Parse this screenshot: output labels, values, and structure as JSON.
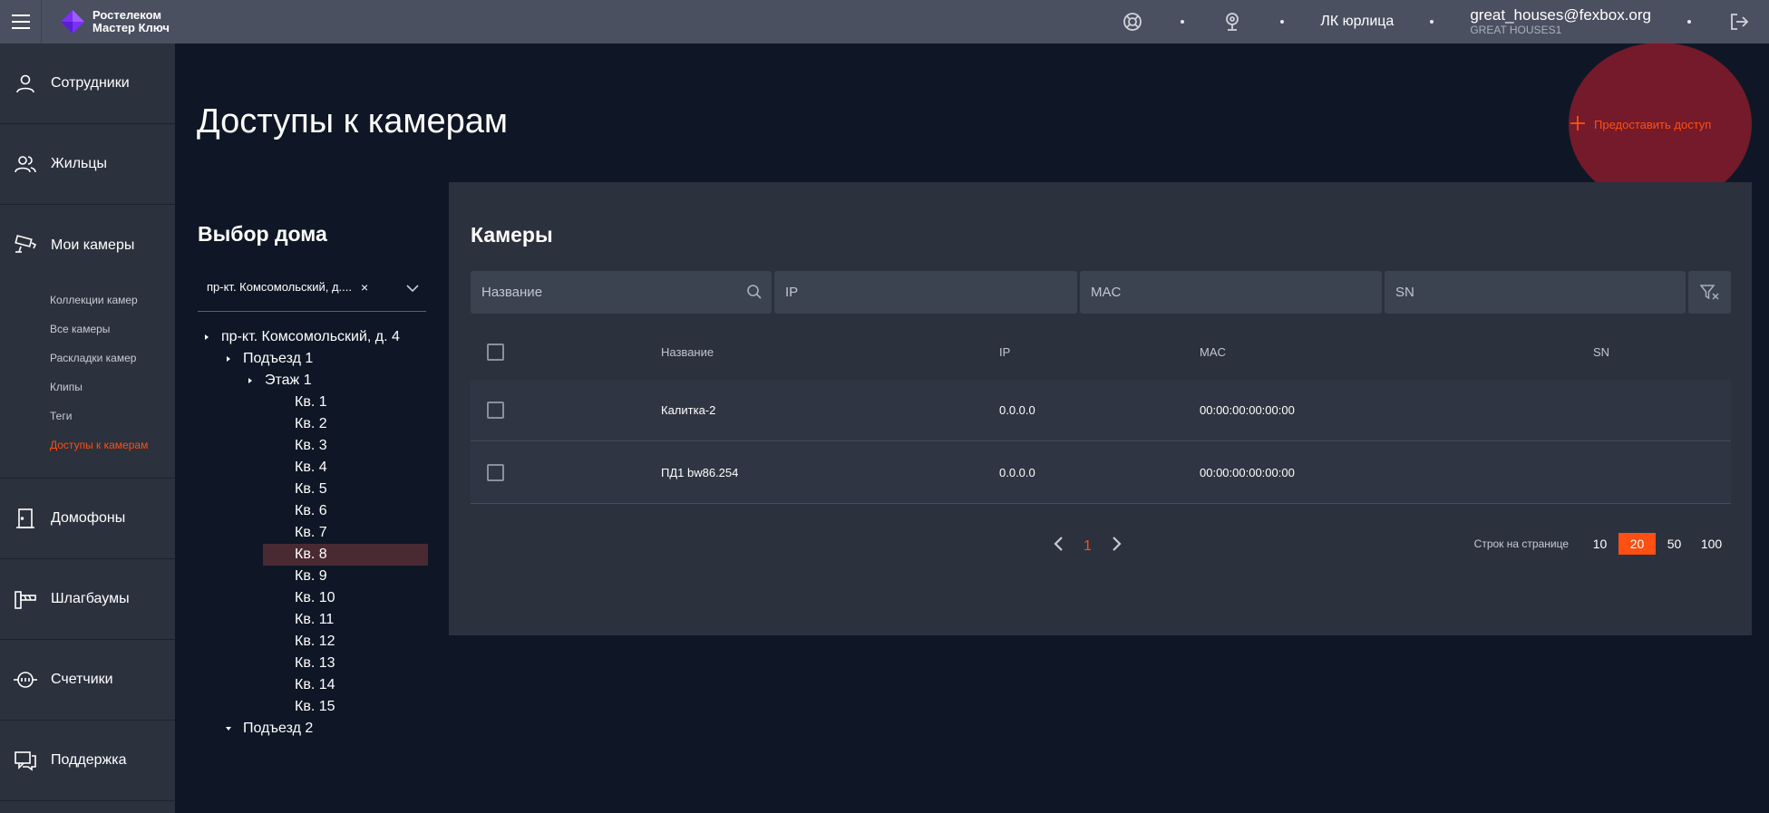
{
  "topbar": {
    "logo_line1": "Ростелеком",
    "logo_line2": "Мастер Ключ",
    "lk_label": "ЛК юрлица",
    "user_email": "great_houses@fexbox.org",
    "user_org": "GREAT HOUSES1"
  },
  "sidebar": {
    "employees": "Сотрудники",
    "residents": "Жильцы",
    "my_cameras": "Мои камеры",
    "sub": {
      "collections": "Коллекции камер",
      "all": "Все камеры",
      "layouts": "Раскладки камер",
      "clips": "Клипы",
      "tags": "Теги",
      "access": "Доступы к камерам"
    },
    "intercoms": "Домофоны",
    "barriers": "Шлагбаумы",
    "meters": "Счетчики",
    "support": "Поддержка"
  },
  "page": {
    "title": "Доступы к камерам",
    "grant_button": "Предоставить доступ",
    "house_title": "Выбор дома",
    "house_chip": "пр-кт. Комсомольский, д....",
    "chip_close": "×"
  },
  "tree": {
    "house": "пр-кт. Комсомольский, д. 4",
    "entrance1": "Подъезд 1",
    "floor1": "Этаж 1",
    "flats": [
      "Кв. 1",
      "Кв. 2",
      "Кв. 3",
      "Кв. 4",
      "Кв. 5",
      "Кв. 6",
      "Кв. 7",
      "Кв. 8",
      "Кв. 9",
      "Кв. 10",
      "Кв. 11",
      "Кв. 12",
      "Кв. 13",
      "Кв. 14",
      "Кв. 15"
    ],
    "entrance2": "Подъезд 2"
  },
  "cameras": {
    "title": "Камеры",
    "filter_name_placeholder": "Название",
    "filter_ip_placeholder": "IP",
    "filter_mac_placeholder": "MAC",
    "filter_sn_placeholder": "SN",
    "columns": {
      "name": "Название",
      "ip": "IP",
      "mac": "MAC",
      "sn": "SN"
    },
    "rows": [
      {
        "name": "Калитка-2",
        "ip": "0.0.0.0",
        "mac": "00:00:00:00:00:00",
        "sn": ""
      },
      {
        "name": "ПД1 bw86.254",
        "ip": "0.0.0.0",
        "mac": "00:00:00:00:00:00",
        "sn": ""
      }
    ],
    "page": "1",
    "rows_per_page_label": "Строк на странице",
    "per_page_options": [
      "10",
      "20",
      "50",
      "100"
    ],
    "per_page_selected": "20"
  },
  "colors": {
    "accent": "#ff4f12",
    "sidebar": "#2b313d",
    "background": "#0f1726",
    "topbar": "#4a5060"
  }
}
